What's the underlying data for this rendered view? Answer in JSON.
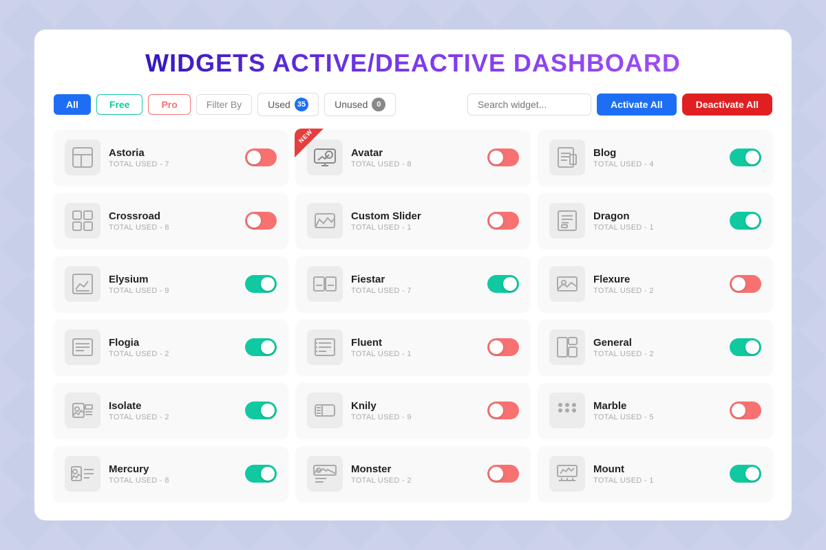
{
  "title": "WIDGETS ACTIVE/DEACTIVE DASHBOARD",
  "toolbar": {
    "all_label": "All",
    "free_label": "Free",
    "pro_label": "Pro",
    "filter_label": "Filter By",
    "used_label": "Used",
    "used_count": "35",
    "unused_label": "Unused",
    "unused_count": "0",
    "search_placeholder": "Search widget...",
    "activate_label": "Activate All",
    "deactivate_label": "Deactivate All"
  },
  "widgets": [
    {
      "name": "Astoria",
      "used": "TOTAL USED - 7",
      "state": "off",
      "new": false,
      "icon": "layout"
    },
    {
      "name": "Avatar",
      "used": "TOTAL USED - 8",
      "state": "off",
      "new": true,
      "icon": "monitor"
    },
    {
      "name": "Blog",
      "used": "TOTAL USED - 4",
      "state": "on",
      "new": false,
      "icon": "doc"
    },
    {
      "name": "Crossroad",
      "used": "TOTAL USED - 8",
      "state": "off",
      "new": false,
      "icon": "grid"
    },
    {
      "name": "Custom Slider",
      "used": "TOTAL USED - 1",
      "state": "off",
      "new": false,
      "icon": "slider"
    },
    {
      "name": "Dragon",
      "used": "TOTAL USED - 1",
      "state": "on",
      "new": false,
      "icon": "doc2"
    },
    {
      "name": "Elysium",
      "used": "TOTAL USED - 9",
      "state": "on",
      "new": false,
      "icon": "chart"
    },
    {
      "name": "Fiestar",
      "used": "TOTAL USED - 7",
      "state": "on",
      "new": false,
      "icon": "gallery"
    },
    {
      "name": "Flexure",
      "used": "TOTAL USED - 2",
      "state": "off",
      "new": false,
      "icon": "image"
    },
    {
      "name": "Flogia",
      "used": "TOTAL USED - 2",
      "state": "on",
      "new": false,
      "icon": "lines"
    },
    {
      "name": "Fluent",
      "used": "TOTAL USED - 1",
      "state": "off",
      "new": false,
      "icon": "list"
    },
    {
      "name": "General",
      "used": "TOTAL USED - 2",
      "state": "on",
      "new": false,
      "icon": "lines2"
    },
    {
      "name": "Isolate",
      "used": "TOTAL USED - 2",
      "state": "on",
      "new": false,
      "icon": "image2"
    },
    {
      "name": "Knily",
      "used": "TOTAL USED - 9",
      "state": "off",
      "new": false,
      "icon": "ticket"
    },
    {
      "name": "Marble",
      "used": "TOTAL USED - 5",
      "state": "off",
      "new": false,
      "icon": "dots"
    },
    {
      "name": "Mercury",
      "used": "TOTAL USED - 8",
      "state": "on",
      "new": false,
      "icon": "imgtext"
    },
    {
      "name": "Monster",
      "used": "TOTAL USED - 2",
      "state": "off",
      "new": false,
      "icon": "imgcard"
    },
    {
      "name": "Mount",
      "used": "TOTAL USED - 1",
      "state": "on",
      "new": false,
      "icon": "chart2"
    }
  ]
}
